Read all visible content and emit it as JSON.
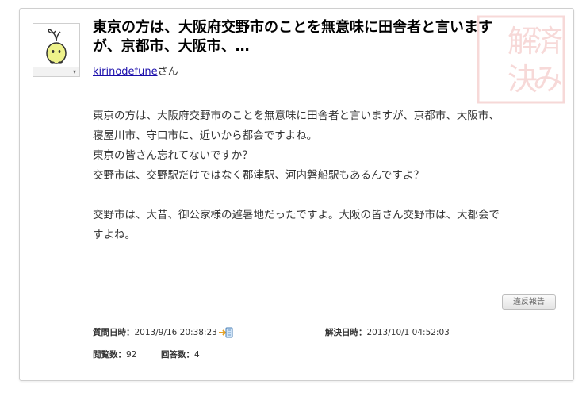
{
  "question": {
    "title": "東京の方は、大阪府交野市のことを無意味に田舎者と言いますが、京都市、大阪市、…",
    "asker_name": "kirinodefune",
    "asker_suffix": "さん",
    "body_lines": [
      "東京の方は、大阪府交野市のことを無意味に田舎者と言いますが、京都市、大阪市、",
      "寝屋川市、守口市に、近いから都会ですよね。",
      "東京の皆さん忘れてないですか？",
      "交野市は、交野駅だけではなく郡津駅、河内磐船駅もあるんですよ？",
      "",
      "交野市は、大昔、御公家様の避暑地だったですよ。大阪の皆さん交野市は、大都会で",
      "すよね。"
    ],
    "report_label": "違反報告",
    "asked_label": "質問日時：",
    "asked_value": "2013/9/16 20:38:23",
    "resolved_label": "解決日時：",
    "resolved_value": "2013/10/1 04:52:03",
    "views_label": "閲覧数：",
    "views_value": "92",
    "answers_label": "回答数：",
    "answers_value": "4",
    "stamp_text": "解決済み"
  },
  "icons": {
    "avatar": "sprout-character-avatar",
    "avatar_menu": "chevron-down-icon",
    "clip": "clip-icon",
    "stamp": "resolved-stamp"
  },
  "colors": {
    "link": "#1a0dab",
    "stamp": "#d9534f",
    "border": "#cfcfcf"
  }
}
